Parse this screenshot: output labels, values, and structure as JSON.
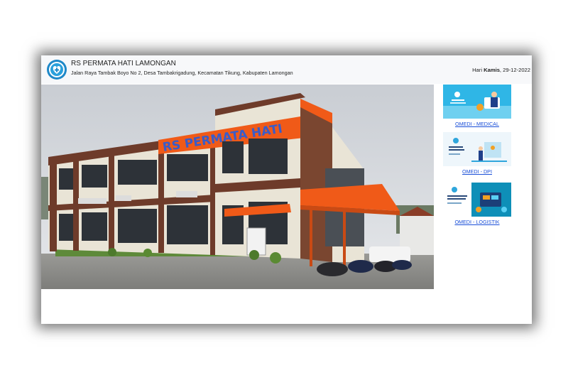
{
  "header": {
    "hospital_name": "RS PERMATA HATI LAMONGAN",
    "address": "Jalan Raya Tambak Boyo No 2, Desa Tambakrigadung, Kecamatan Tikung, Kabupaten Lamongan",
    "day_prefix": "Hari ",
    "day_name": "Kamis",
    "date": ", 29-12-2022"
  },
  "hero": {
    "building_sign": "RS PERMATA HATI",
    "description": "hospital building photo"
  },
  "modules": [
    {
      "label": "OMEDI - MEDICAL",
      "thumb_title": "OMEDI RS Permata Hati"
    },
    {
      "label": "OMEDI - DPI",
      "thumb_title": "Apotek Pharmacy Inventory"
    },
    {
      "label": "OMEDI - LOGISTIK",
      "thumb_title": "Logistic Management System"
    }
  ],
  "colors": {
    "link": "#1a4fd8",
    "accent_orange": "#f05a18",
    "header_bg": "#f7f8fa",
    "logo_blue": "#1e88c8"
  }
}
